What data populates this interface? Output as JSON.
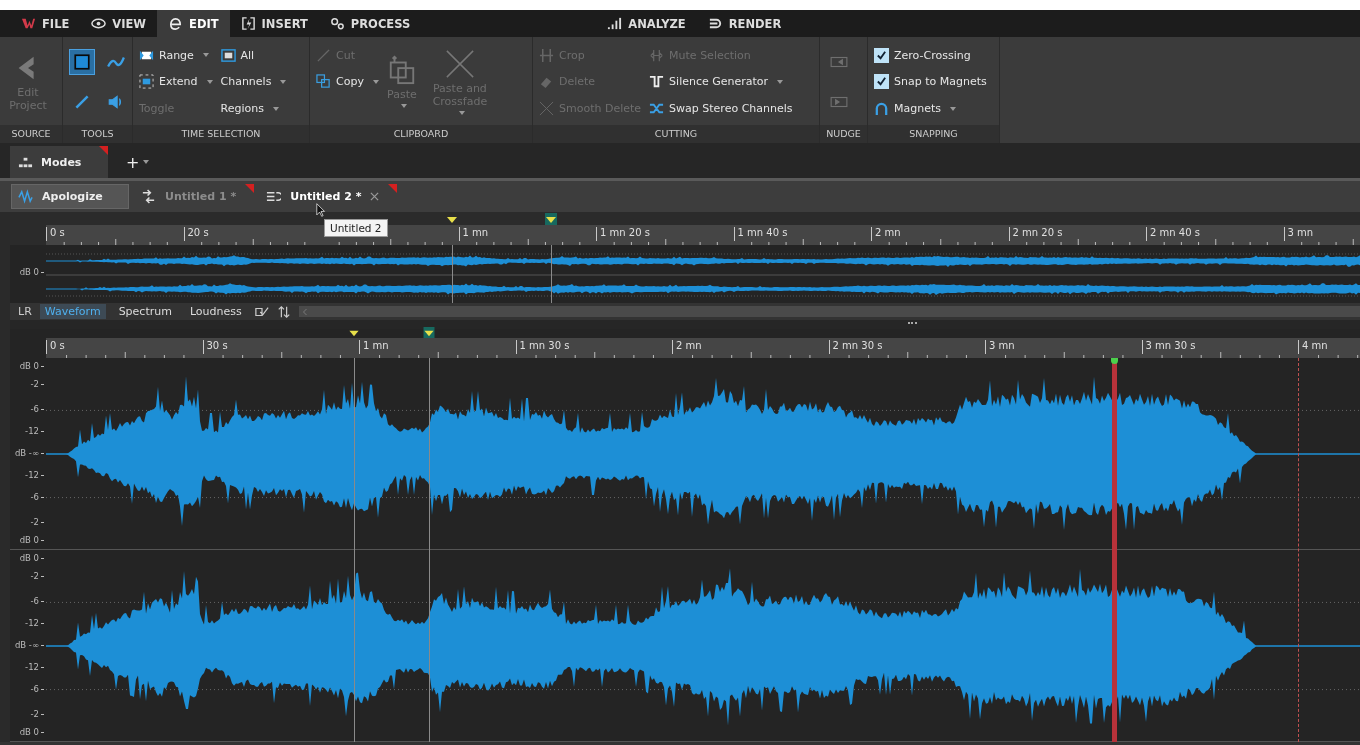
{
  "menu_tabs": [
    {
      "label": "FILE",
      "selected": false
    },
    {
      "label": "VIEW",
      "selected": false
    },
    {
      "label": "EDIT",
      "selected": true
    },
    {
      "label": "INSERT",
      "selected": false
    },
    {
      "label": "PROCESS",
      "selected": false
    },
    {
      "label": "ANALYZE",
      "selected": false
    },
    {
      "label": "RENDER",
      "selected": false
    }
  ],
  "ribbon_groups": [
    {
      "title": "SOURCE",
      "items": [
        {
          "kind": "large",
          "label": "Edit Project",
          "disabled": true,
          "dropdown": false
        }
      ]
    },
    {
      "title": "TOOLS",
      "items": [
        {
          "kind": "icon",
          "selected": true,
          "disabled": false
        },
        {
          "kind": "icon",
          "selected": false,
          "disabled": false
        },
        {
          "kind": "icon",
          "selected": false,
          "disabled": false
        },
        {
          "kind": "icon",
          "selected": false,
          "disabled": false
        }
      ]
    },
    {
      "title": "TIME SELECTION",
      "items": [
        {
          "kind": "small",
          "label": "Range",
          "disabled": false,
          "dropdown": true
        },
        {
          "kind": "small",
          "label": "Extend",
          "disabled": false,
          "dropdown": true
        },
        {
          "kind": "small",
          "label": "Toggle",
          "disabled": true,
          "dropdown": false
        },
        {
          "kind": "small",
          "label": "All",
          "disabled": false,
          "dropdown": false
        },
        {
          "kind": "small",
          "label": "Channels",
          "disabled": false,
          "dropdown": true
        },
        {
          "kind": "small",
          "label": "Regions",
          "disabled": false,
          "dropdown": true
        }
      ]
    },
    {
      "title": "CLIPBOARD",
      "items": [
        {
          "kind": "small",
          "label": "Cut",
          "disabled": true,
          "dropdown": false
        },
        {
          "kind": "small",
          "label": "Copy",
          "disabled": false,
          "dropdown": true
        },
        {
          "kind": "large",
          "label": "Paste",
          "disabled": true,
          "dropdown": true
        },
        {
          "kind": "large",
          "label": "Paste and Crossfade",
          "disabled": true,
          "dropdown": true
        }
      ]
    },
    {
      "title": "CUTTING",
      "items": [
        {
          "kind": "small",
          "label": "Crop",
          "disabled": true,
          "dropdown": false
        },
        {
          "kind": "small",
          "label": "Delete",
          "disabled": true,
          "dropdown": false
        },
        {
          "kind": "small",
          "label": "Smooth Delete",
          "disabled": true,
          "dropdown": false
        },
        {
          "kind": "small",
          "label": "Mute Selection",
          "disabled": true,
          "dropdown": false
        },
        {
          "kind": "small",
          "label": "Silence Generator",
          "disabled": false,
          "dropdown": true
        },
        {
          "kind": "small",
          "label": "Swap Stereo Channels",
          "disabled": false,
          "dropdown": false
        }
      ]
    },
    {
      "title": "NUDGE",
      "items": [
        {
          "kind": "icon",
          "selected": false,
          "disabled": true
        },
        {
          "kind": "icon",
          "selected": false,
          "disabled": true
        }
      ]
    },
    {
      "title": "SNAPPING",
      "items": [
        {
          "kind": "checkbox",
          "label": "Zero-Crossing",
          "checked": true
        },
        {
          "kind": "checkbox",
          "label": "Snap to Magnets",
          "checked": true
        },
        {
          "kind": "small",
          "label": "Magnets",
          "disabled": false,
          "dropdown": true
        }
      ]
    }
  ],
  "mode_tab": {
    "label": "Modes",
    "modified": true
  },
  "add_button": {
    "label": "+"
  },
  "file_tabs": [
    {
      "label": "Apologize",
      "selected": true,
      "hovered": false,
      "modified": false,
      "closable": false
    },
    {
      "label": "Untitled 1 *",
      "selected": false,
      "hovered": false,
      "modified": true,
      "closable": false
    },
    {
      "label": "Untitled 2 *",
      "selected": false,
      "hovered": true,
      "modified": true,
      "closable": true
    }
  ],
  "tooltip": "Untitled 2",
  "overview": {
    "ruler_labels": [
      "0 s",
      "20 s",
      "1 mn",
      "1 mn 20 s",
      "1 mn 40 s",
      "2 mn",
      "2 mn 20 s",
      "2 mn 40 s",
      "3 mn"
    ],
    "db_label": "dB 0"
  },
  "view_bar": {
    "channel_label": "LR",
    "tabs": [
      {
        "label": "Waveform",
        "selected": true
      },
      {
        "label": "Spectrum",
        "selected": false
      },
      {
        "label": "Loudness",
        "selected": false
      }
    ]
  },
  "main": {
    "ruler_labels": [
      "0 s",
      "30 s",
      "1 mn",
      "1 mn 30 s",
      "2 mn",
      "2 mn 30 s",
      "3 mn",
      "3 mn 30 s",
      "4 mn"
    ],
    "channels": [
      {
        "db_labels": [
          "dB 0",
          "-2",
          "-6",
          "-12",
          "dB -∞",
          "-12",
          "-6",
          "-2",
          "dB 0"
        ]
      },
      {
        "db_labels": [
          "dB 0",
          "-2",
          "-6",
          "-12",
          "dB -∞",
          "-12",
          "-6",
          "-2",
          "dB 0"
        ]
      }
    ]
  }
}
